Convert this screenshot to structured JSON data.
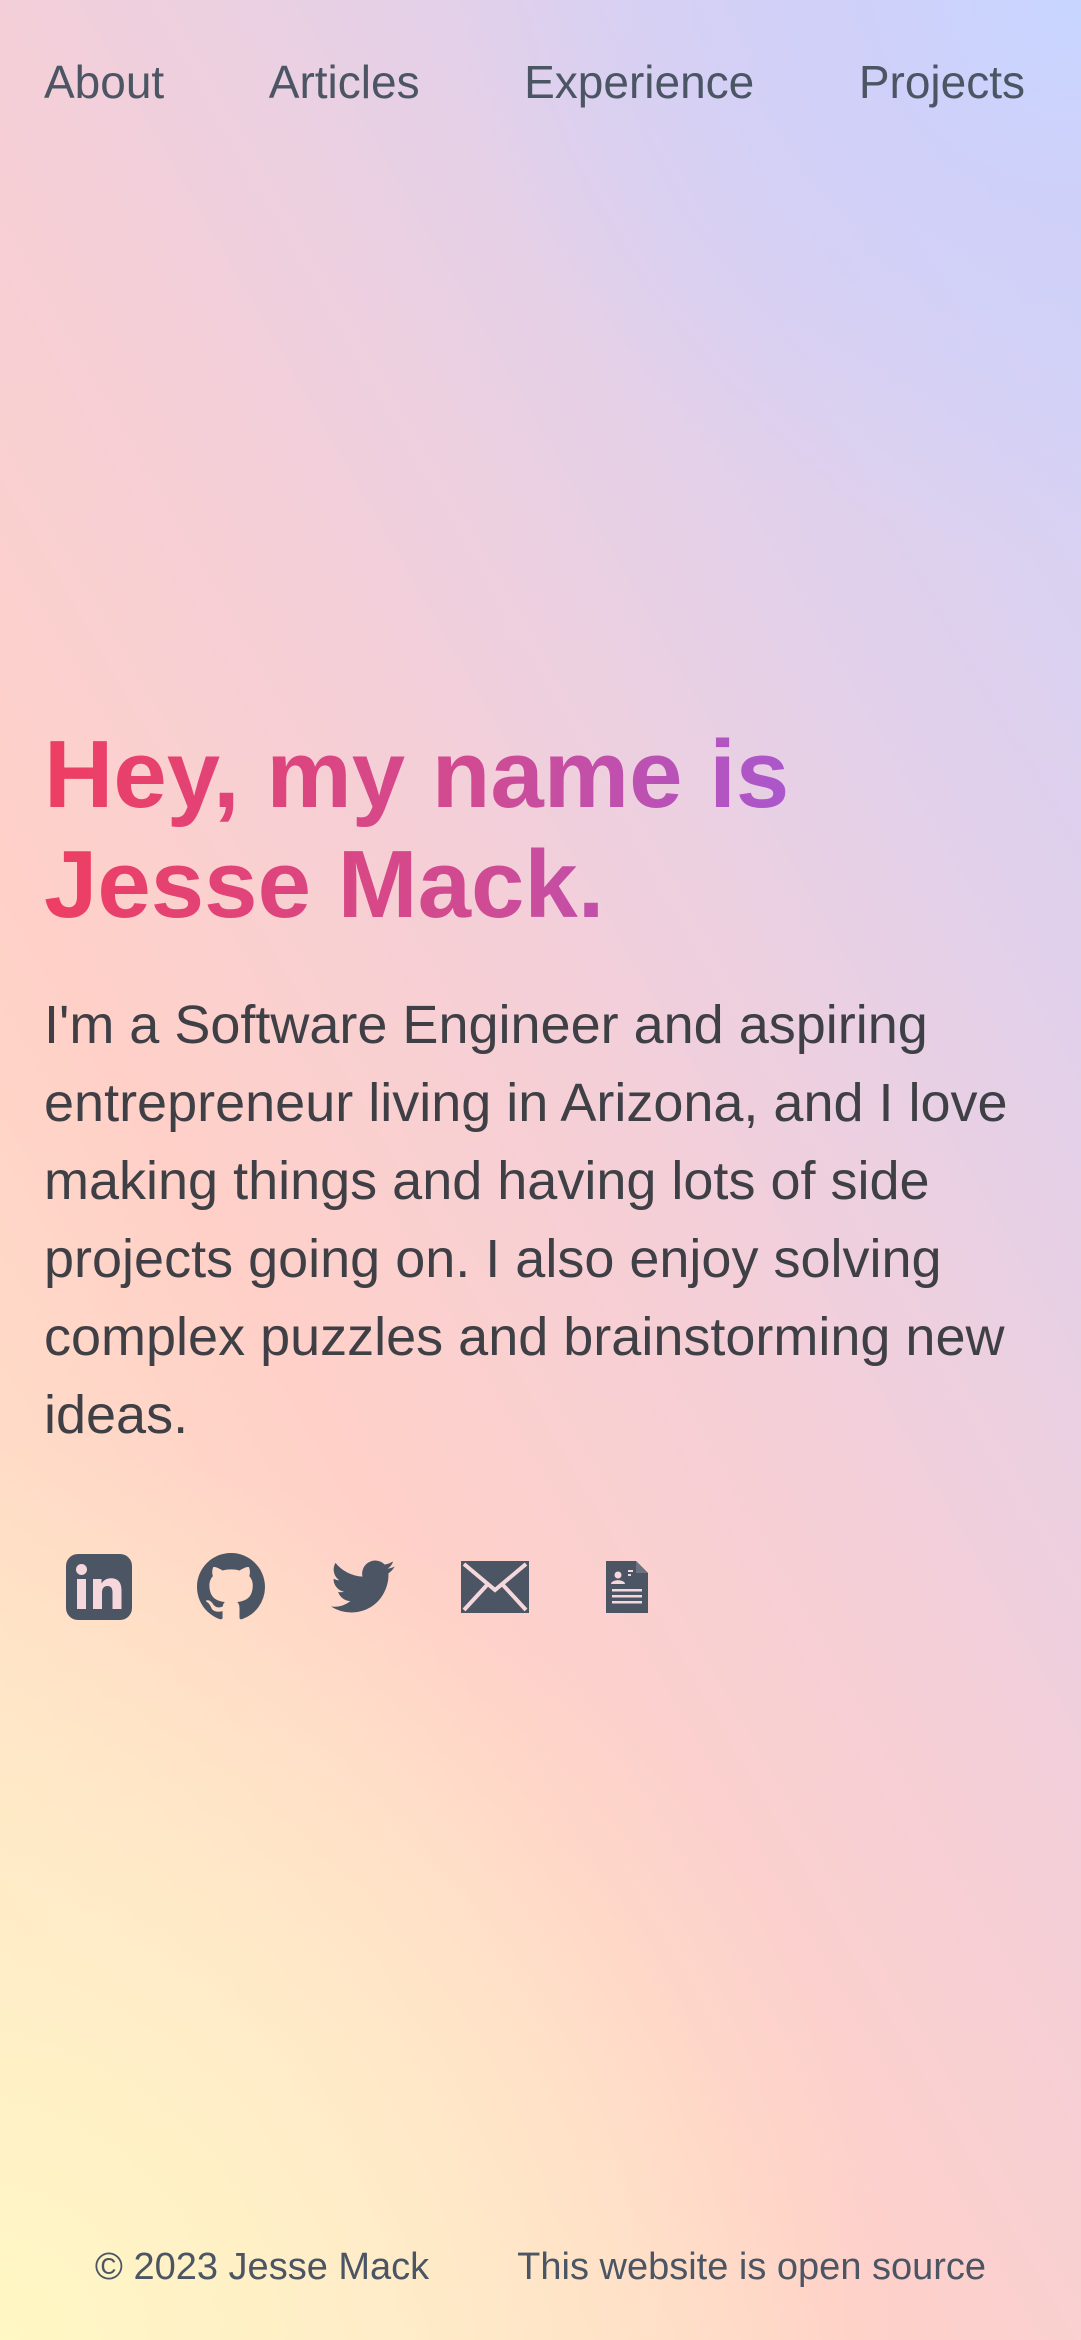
{
  "nav": {
    "items": [
      {
        "label": "About"
      },
      {
        "label": "Articles"
      },
      {
        "label": "Experience"
      },
      {
        "label": "Projects"
      }
    ]
  },
  "hero": {
    "headline": "Hey, my name is Jesse Mack.",
    "intro": "I'm a Software Engineer and aspiring entrepreneur living in Arizona, and I love making things and having lots of side projects going on. I also enjoy solving complex puzzles and brainstorming new ideas.",
    "gradient_colors": [
      "#ee3e63",
      "#cf4b94",
      "#a459d8"
    ]
  },
  "socials": [
    {
      "icon": "linkedin-icon"
    },
    {
      "icon": "github-icon"
    },
    {
      "icon": "twitter-icon"
    },
    {
      "icon": "mail-icon"
    },
    {
      "icon": "resume-icon"
    }
  ],
  "footer": {
    "copyright": "© 2023 Jesse Mack",
    "open_source": "This website is open source"
  },
  "colors": {
    "text": "#3f3f46",
    "icon": "#4b5563"
  }
}
